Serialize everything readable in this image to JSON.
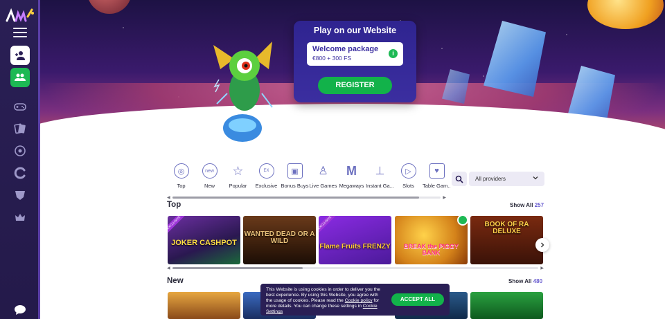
{
  "sidebar": {
    "logo_icon": "brand-logo",
    "items": [
      {
        "icon": "user-plus-icon",
        "active": "white"
      },
      {
        "icon": "users-icon",
        "active": "green"
      },
      {
        "icon": "gamepad-icon"
      },
      {
        "icon": "cards-icon"
      },
      {
        "icon": "roulette-icon"
      },
      {
        "icon": "swirl-icon"
      },
      {
        "icon": "shield-icon"
      },
      {
        "icon": "crown-icon"
      }
    ],
    "chat_icon": "chat-icon"
  },
  "promo": {
    "title": "Play on our Website",
    "package_name": "Welcome package",
    "package_value": "€800 + 300 FS",
    "info_glyph": "i",
    "register_label": "REGISTER"
  },
  "categories": [
    {
      "label": "Top",
      "icon": "top-icon"
    },
    {
      "label": "New",
      "icon": "new-icon"
    },
    {
      "label": "Popular",
      "icon": "star-icon"
    },
    {
      "label": "Exclusive",
      "icon": "exclusive-icon"
    },
    {
      "label": "Bonus Buys",
      "icon": "gift-icon"
    },
    {
      "label": "Live Games",
      "icon": "dealer-icon"
    },
    {
      "label": "Megaways",
      "icon": "megaways-icon"
    },
    {
      "label": "Instant Ga...",
      "icon": "joystick-icon"
    },
    {
      "label": "Slots",
      "icon": "play-icon"
    },
    {
      "label": "Table Gam...",
      "icon": "table-cards-icon"
    }
  ],
  "providers": {
    "selected": "All providers"
  },
  "sections": {
    "top": {
      "title": "Top",
      "show_all_label": "Show All",
      "count": "257"
    },
    "new": {
      "title": "New",
      "show_all_label": "Show All",
      "count": "480"
    }
  },
  "top_games": [
    {
      "title": "JOKER CASHPOT",
      "ribbon": "EXCLUSIVE"
    },
    {
      "title": "WANTED DEAD OR A WILD",
      "ribbon": ""
    },
    {
      "title": "Flame Fruits FRENZY",
      "ribbon": "EXCLUSIVE"
    },
    {
      "title": "BREAK the PIGGY BANK",
      "ribbon": ""
    },
    {
      "title": "BOOK OF RA DELUXE",
      "ribbon": ""
    }
  ],
  "cookie": {
    "text": "This Website is using cookies in order to deliver you the best experience. By using this Website, you agree with the usage of cookies. Please read the",
    "policy_link": "Cookie policy",
    "text2": "for more details. You can change these settings in",
    "settings_link": "Cookie Settings",
    "accept_label": "ACCEPT ALL"
  },
  "colors": {
    "sidebar_bg": "#2a1f55",
    "accent_purple": "#3b2ea0",
    "green": "#12b24a",
    "count_color": "#6b5fd0"
  }
}
